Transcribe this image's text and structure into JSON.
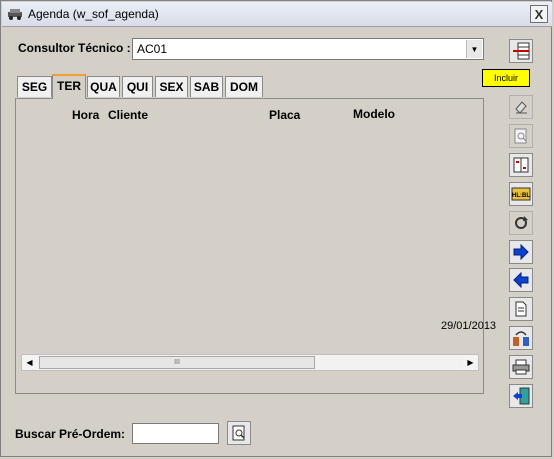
{
  "window": {
    "title": "Agenda  (w_sof_agenda)",
    "close_label": "X"
  },
  "consultor": {
    "label": "Consultor Técnico :",
    "value": "AC01"
  },
  "tabs": [
    {
      "label": "SEG"
    },
    {
      "label": "TER"
    },
    {
      "label": "QUA"
    },
    {
      "label": "QUI"
    },
    {
      "label": "SEX"
    },
    {
      "label": "SAB"
    },
    {
      "label": "DOM"
    }
  ],
  "active_tab": "TER",
  "grid": {
    "columns": [
      "Hora",
      "Cliente",
      "Placa",
      "Modelo"
    ],
    "date": "29/01/2013",
    "scroll_thumb": "III"
  },
  "toolbar": {
    "tooltip": "Incluir",
    "buttons": [
      {
        "icon": "add-row-icon"
      },
      {
        "icon": "eraser-icon"
      },
      {
        "icon": "preview-icon"
      },
      {
        "icon": "columns-icon"
      },
      {
        "icon": "hl-bl-icon"
      },
      {
        "icon": "refresh-icon"
      },
      {
        "icon": "arrow-right-icon"
      },
      {
        "icon": "arrow-left-icon"
      },
      {
        "icon": "document-icon"
      },
      {
        "icon": "exchange-icon"
      },
      {
        "icon": "print-icon"
      },
      {
        "icon": "exit-icon"
      }
    ]
  },
  "search": {
    "label": "Buscar Pré-Ordem:",
    "value": ""
  },
  "colors": {
    "active_tab_accent": "#f0a030",
    "tooltip_bg": "#ffff00",
    "arrow_blue": "#1040d0"
  }
}
